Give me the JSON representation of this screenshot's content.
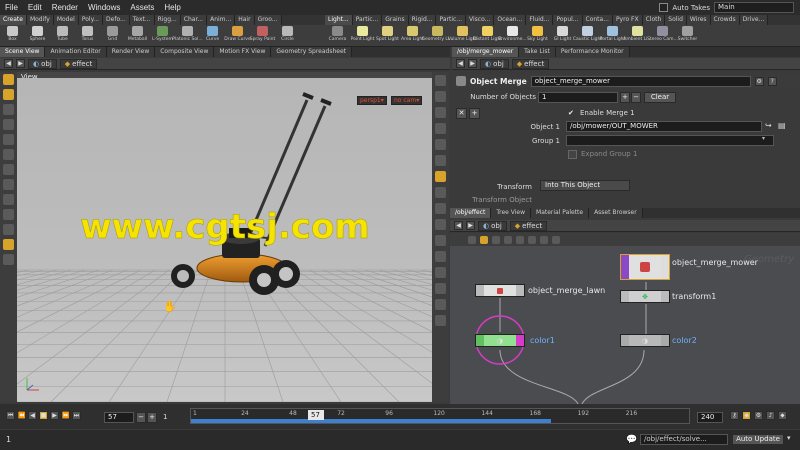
{
  "menu": [
    "File",
    "Edit",
    "Render",
    "Windows",
    "Assets",
    "Help"
  ],
  "auto_takes": "Auto Takes",
  "desktop": "Main",
  "shelf_tabs_left": [
    "Create",
    "Modify",
    "Model",
    "Poly...",
    "Defo...",
    "Text...",
    "Rigg...",
    "Char...",
    "Anim...",
    "Hair",
    "Groo..."
  ],
  "shelf_tabs_right": [
    "Light...",
    "Partic...",
    "Grains",
    "Rigid...",
    "Partic...",
    "Visco...",
    "Ocean...",
    "Fluid...",
    "Popul...",
    "Conta...",
    "Pyro FX",
    "Cloth",
    "Solid",
    "Wires",
    "Crowds",
    "Drive..."
  ],
  "shelf_tools_left": [
    {
      "label": "Box",
      "color": "#c8c8c8"
    },
    {
      "label": "Sphere",
      "color": "#d0d0d0"
    },
    {
      "label": "Tube",
      "color": "#bbbbbb"
    },
    {
      "label": "Torus",
      "color": "#c0c0c0"
    },
    {
      "label": "Grid",
      "color": "#9a9a9a"
    },
    {
      "label": "Metaball",
      "color": "#a6a6a6"
    },
    {
      "label": "L-System",
      "color": "#6a9a5a"
    },
    {
      "label": "Platonic Sol...",
      "color": "#b0b0b0"
    },
    {
      "label": "Curve",
      "color": "#7ab0d8"
    },
    {
      "label": "Draw Curve",
      "color": "#d8a040"
    },
    {
      "label": "Spray Paint",
      "color": "#c06060"
    },
    {
      "label": "Circle",
      "color": "#b8b8b8"
    }
  ],
  "shelf_tools_right": [
    {
      "label": "Camera",
      "color": "#8a8a8a"
    },
    {
      "label": "Point Light",
      "color": "#e8e8a0"
    },
    {
      "label": "Spot Light",
      "color": "#e0d080"
    },
    {
      "label": "Area Light",
      "color": "#d8c870"
    },
    {
      "label": "Geometry Li...",
      "color": "#c8b860"
    },
    {
      "label": "Volume Light",
      "color": "#e0c060"
    },
    {
      "label": "Distant Light",
      "color": "#f0d060"
    },
    {
      "label": "Environme...",
      "color": "#e8e8e8"
    },
    {
      "label": "Sky Light",
      "color": "#f0c040"
    },
    {
      "label": "GI Light",
      "color": "#d8d8d8"
    },
    {
      "label": "Caustic Light",
      "color": "#c0d0e0"
    },
    {
      "label": "Portal Light",
      "color": "#a0c0e0"
    },
    {
      "label": "Ambient Li...",
      "color": "#e0e0a0"
    },
    {
      "label": "Stereo Cam...",
      "color": "#9090a0"
    },
    {
      "label": "Switcher",
      "color": "#a0a0a0"
    }
  ],
  "left_pane_tabs": [
    "Scene View",
    "Animation Editor",
    "Render View",
    "Composite View",
    "Motion FX View",
    "Geometry Spreadsheet"
  ],
  "right_pane_tabs": [
    "/obj/merge_mower",
    "Take List",
    "Performance Monitor"
  ],
  "path": {
    "root": "obj",
    "node": "effect"
  },
  "viewport": {
    "title": "View",
    "persp": "persp1▾",
    "cam": "no cam▾"
  },
  "params": {
    "node_type": "Object Merge",
    "node_name": "object_merge_mower",
    "num_objects_label": "Number of Objects",
    "num_objects": "1",
    "clear": "Clear",
    "enable_merge": "Enable Merge 1",
    "object1_label": "Object 1",
    "object1_value": "/obj/mower/OUT_MOWER",
    "group1_label": "Group 1",
    "expand_group": "Expand Group 1",
    "transform_label": "Transform",
    "transform_value": "Into This Object",
    "transform_object": "Transform Object"
  },
  "net_tabs": [
    "/obj/effect",
    "Tree View",
    "Material Palette",
    "Asset Browser"
  ],
  "net_path": {
    "root": "obj",
    "node": "effect"
  },
  "net_watermark": "Geometry",
  "nodes": {
    "merge_mower": "object_merge_mower",
    "merge_lawn": "object_merge_lawn",
    "transform1": "transform1",
    "color1": "color1",
    "color2": "color2"
  },
  "watermark": "www.cgtsj.com",
  "timeline": {
    "current": "57",
    "step": "1",
    "start": "1",
    "end": "240",
    "ticks": [
      "1",
      "24",
      "48",
      "72",
      "96",
      "120",
      "144",
      "168",
      "192",
      "216"
    ],
    "current_frame_fraction": 0.233,
    "range_fraction": 0.72
  },
  "status": {
    "path": "/obj/effect/solve...",
    "update": "Auto Update"
  },
  "colors": {
    "accent": "#d7a32a",
    "selected_node": "#d63cc8",
    "blue_label": "#6fb4ff"
  }
}
